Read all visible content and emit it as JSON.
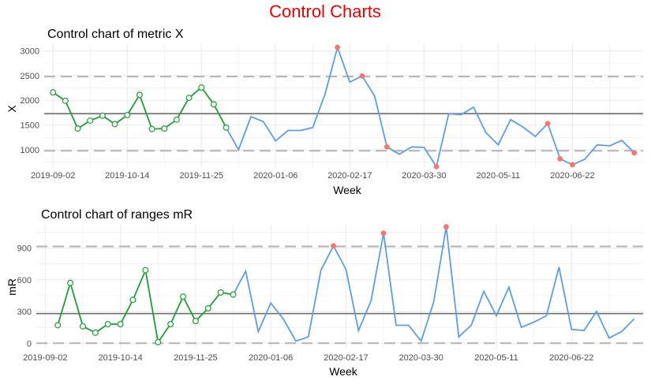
{
  "page": {
    "title": "Control Charts",
    "title_color": "#ee0000"
  },
  "colors": {
    "phase1_line": "#1aa035",
    "phase2_line": "#5b9ee8",
    "center_line": "#707070",
    "limit_line": "#b3b3b3",
    "grid": "#ebebeb",
    "outlier_point": "#f8766d",
    "phase1_point_fill": "#ffffff"
  },
  "chart_data": [
    {
      "type": "line",
      "title": "Control chart of metric X",
      "xlabel": "Week",
      "ylabel": "X",
      "x_ticks": [
        "2019-09-02",
        "2019-10-14",
        "2019-11-25",
        "2020-01-06",
        "2020-02-17",
        "2020-03-30",
        "2020-05-11",
        "2020-06-22"
      ],
      "y_ticks": [
        1000,
        1500,
        2000,
        2500,
        3000
      ],
      "ylim": [
        650,
        3150
      ],
      "grid": true,
      "center_line": 1730,
      "lower_limit": 980,
      "upper_limit": 2480,
      "phase1_weeks": 15,
      "series": [
        {
          "x": [
            "2019-09-02",
            "2019-09-09",
            "2019-09-16",
            "2019-09-23",
            "2019-09-30",
            "2019-10-07",
            "2019-10-14",
            "2019-10-21",
            "2019-10-28",
            "2019-11-04",
            "2019-11-11",
            "2019-11-18",
            "2019-11-25",
            "2019-12-02",
            "2019-12-09",
            "2019-12-16",
            "2019-12-23",
            "2019-12-30",
            "2020-01-06",
            "2020-01-13",
            "2020-01-20",
            "2020-01-27",
            "2020-02-03",
            "2020-02-10",
            "2020-02-17",
            "2020-02-24",
            "2020-03-02",
            "2020-03-09",
            "2020-03-16",
            "2020-03-23",
            "2020-03-30",
            "2020-04-06",
            "2020-04-13",
            "2020-04-20",
            "2020-04-27",
            "2020-05-04",
            "2020-05-11",
            "2020-05-18",
            "2020-05-25",
            "2020-06-01",
            "2020-06-08",
            "2020-06-15",
            "2020-06-22",
            "2020-06-29",
            "2020-07-06",
            "2020-07-13",
            "2020-07-20",
            "2020-07-27"
          ],
          "values": [
            2160,
            1990,
            1430,
            1590,
            1690,
            1520,
            1700,
            2110,
            1420,
            1430,
            1610,
            2050,
            2260,
            1920,
            1450,
            1000,
            1670,
            1570,
            1180,
            1390,
            1390,
            1450,
            2130,
            3070,
            2370,
            2490,
            2090,
            1060,
            910,
            1060,
            1050,
            660,
            1730,
            1710,
            1860,
            1350,
            1100,
            1610,
            1460,
            1270,
            1530,
            820,
            700,
            810,
            1100,
            1080,
            1190,
            940
          ]
        }
      ],
      "out_of_control_x": [
        "2020-02-10",
        "2020-02-24",
        "2020-03-09",
        "2020-04-06",
        "2020-06-08",
        "2020-06-15",
        "2020-06-22",
        "2020-07-27"
      ]
    },
    {
      "type": "line",
      "title": "Control chart of ranges mR",
      "xlabel": "Week",
      "ylabel": "mR",
      "x_ticks": [
        "2019-09-02",
        "2019-10-14",
        "2019-11-25",
        "2020-01-06",
        "2020-02-17",
        "2020-03-30",
        "2020-05-11",
        "2020-06-22"
      ],
      "y_ticks": [
        0,
        300,
        600,
        900
      ],
      "ylim": [
        -50,
        1120
      ],
      "grid": true,
      "center_line": 280,
      "lower_limit": 0,
      "upper_limit": 915,
      "phase1_weeks": 15,
      "series": [
        {
          "x": [
            "2019-09-09",
            "2019-09-16",
            "2019-09-23",
            "2019-09-30",
            "2019-10-07",
            "2019-10-14",
            "2019-10-21",
            "2019-10-28",
            "2019-11-04",
            "2019-11-11",
            "2019-11-18",
            "2019-11-25",
            "2019-12-02",
            "2019-12-09",
            "2019-12-16",
            "2019-12-23",
            "2019-12-30",
            "2020-01-06",
            "2020-01-13",
            "2020-01-20",
            "2020-01-27",
            "2020-02-03",
            "2020-02-10",
            "2020-02-17",
            "2020-02-24",
            "2020-03-02",
            "2020-03-09",
            "2020-03-16",
            "2020-03-23",
            "2020-03-30",
            "2020-04-06",
            "2020-04-13",
            "2020-04-20",
            "2020-04-27",
            "2020-05-04",
            "2020-05-11",
            "2020-05-18",
            "2020-05-25",
            "2020-06-01",
            "2020-06-08",
            "2020-06-15",
            "2020-06-22",
            "2020-06-29",
            "2020-07-06",
            "2020-07-13",
            "2020-07-20",
            "2020-07-27"
          ],
          "values": [
            170,
            570,
            160,
            100,
            180,
            180,
            410,
            690,
            10,
            180,
            440,
            210,
            330,
            480,
            460,
            680,
            110,
            380,
            230,
            20,
            60,
            690,
            920,
            700,
            120,
            400,
            1040,
            170,
            170,
            20,
            390,
            1100,
            60,
            170,
            490,
            260,
            530,
            150,
            200,
            260,
            720,
            130,
            120,
            300,
            50,
            110,
            230
          ]
        }
      ],
      "out_of_control_x": [
        "2020-02-10",
        "2020-03-09",
        "2020-04-13"
      ]
    }
  ]
}
